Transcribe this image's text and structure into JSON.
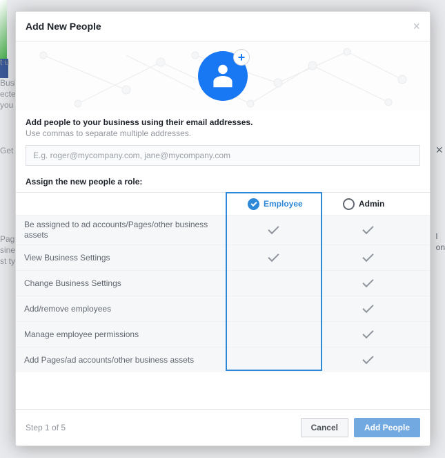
{
  "modal": {
    "title": "Add New People",
    "instruction_bold": "Add people to your business using their email addresses.",
    "instruction_sub": "Use commas to separate multiple addresses.",
    "email_placeholder": "E.g. roger@mycompany.com, jane@mycompany.com",
    "assign_label": "Assign the new people a role:",
    "roles": {
      "employee": "Employee",
      "admin": "Admin"
    },
    "selected_role": "employee",
    "permissions": [
      {
        "label": "Be assigned to ad accounts/Pages/other business assets",
        "employee": true,
        "admin": true
      },
      {
        "label": "View Business Settings",
        "employee": true,
        "admin": true
      },
      {
        "label": "Change Business Settings",
        "employee": false,
        "admin": true
      },
      {
        "label": "Add/remove employees",
        "employee": false,
        "admin": true
      },
      {
        "label": "Manage employee permissions",
        "employee": false,
        "admin": true
      },
      {
        "label": "Add Pages/ad accounts/other business assets",
        "employee": false,
        "admin": true
      }
    ],
    "step_text": "Step 1 of 5",
    "cancel_label": "Cancel",
    "primary_label": "Add People"
  }
}
